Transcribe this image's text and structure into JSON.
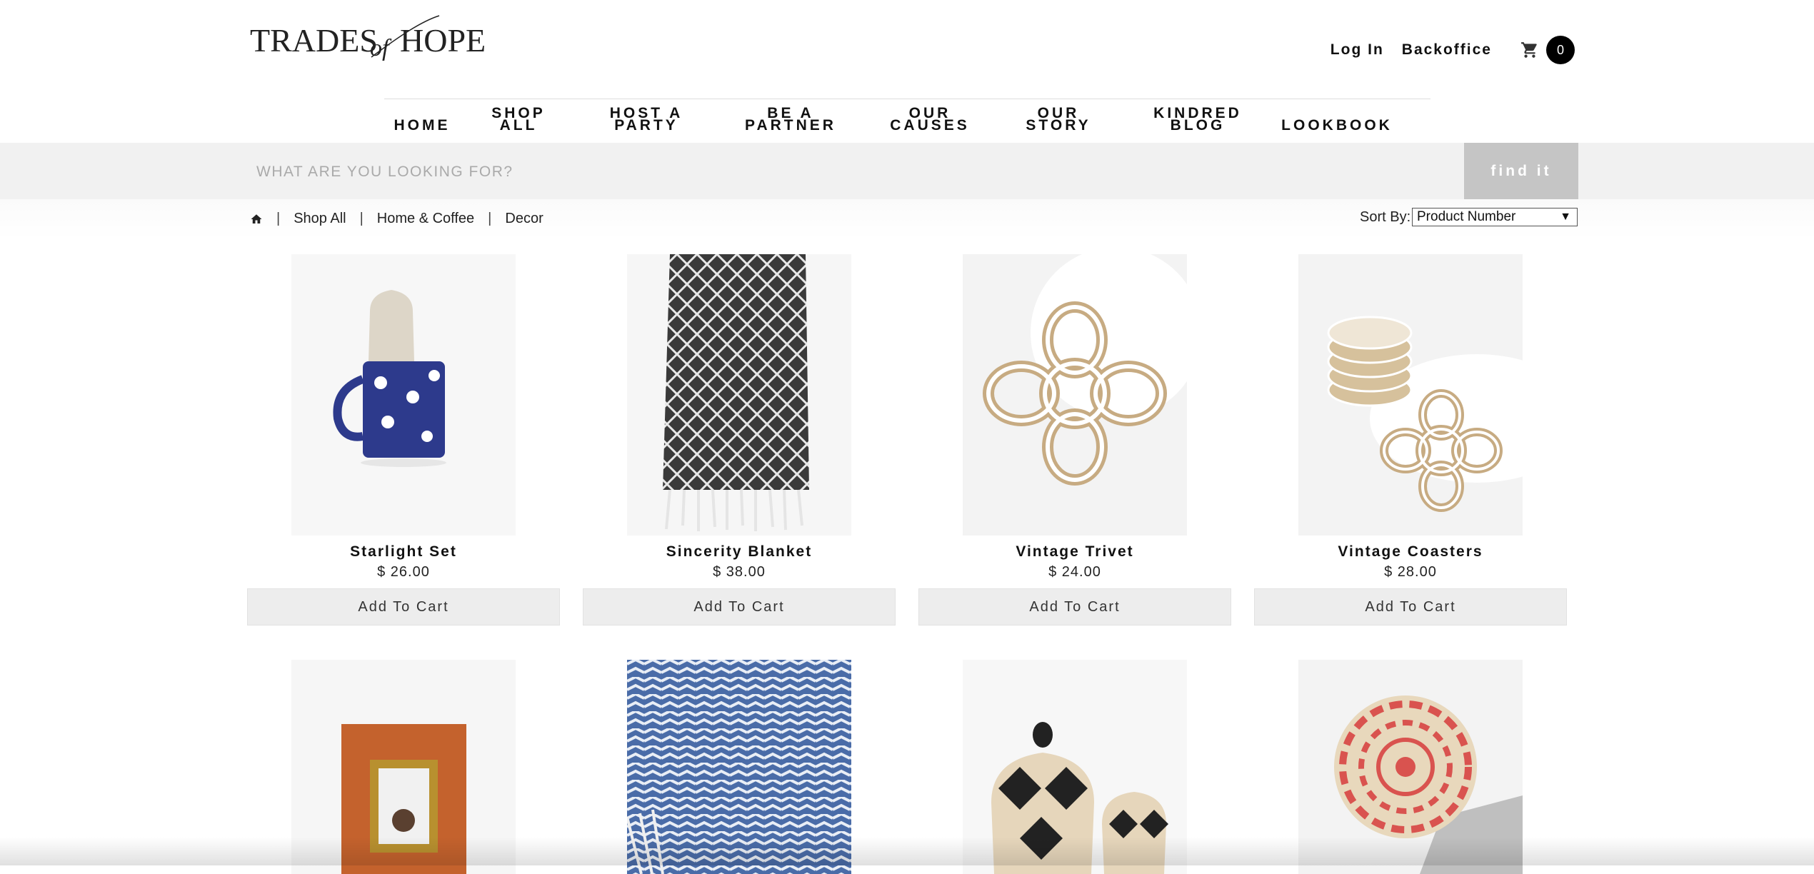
{
  "brand": {
    "logo_text": "TRADES of HOPE"
  },
  "header": {
    "login": "Log In",
    "backoffice": "Backoffice",
    "cart_count": "0"
  },
  "nav": [
    {
      "label": "HOME"
    },
    {
      "label": "SHOP\nALL"
    },
    {
      "label": "HOST A\nPARTY"
    },
    {
      "label": "BE A\nPARTNER"
    },
    {
      "label": "OUR\nCAUSES"
    },
    {
      "label": "OUR\nSTORY"
    },
    {
      "label": "KINDRED\nBLOG"
    },
    {
      "label": "LOOKBOOK"
    }
  ],
  "search": {
    "placeholder": "WHAT ARE YOU LOOKING FOR?",
    "button": "find it"
  },
  "breadcrumb": [
    "Shop All",
    "Home & Coffee",
    "Decor"
  ],
  "sort": {
    "label": "Sort By:",
    "selected": "Product Number"
  },
  "products": [
    {
      "name": "Starlight Set",
      "price": "$ 26.00",
      "cta": "Add To Cart"
    },
    {
      "name": "Sincerity Blanket",
      "price": "$ 38.00",
      "cta": "Add To Cart"
    },
    {
      "name": "Vintage Trivet",
      "price": "$ 24.00",
      "cta": "Add To Cart"
    },
    {
      "name": "Vintage Coasters",
      "price": "$ 28.00",
      "cta": "Add To Cart"
    }
  ],
  "colors": {
    "accent": "#000000",
    "button_bg": "#ededed",
    "search_bg": "#f1f1f1",
    "find_btn": "#c5c5c5"
  }
}
